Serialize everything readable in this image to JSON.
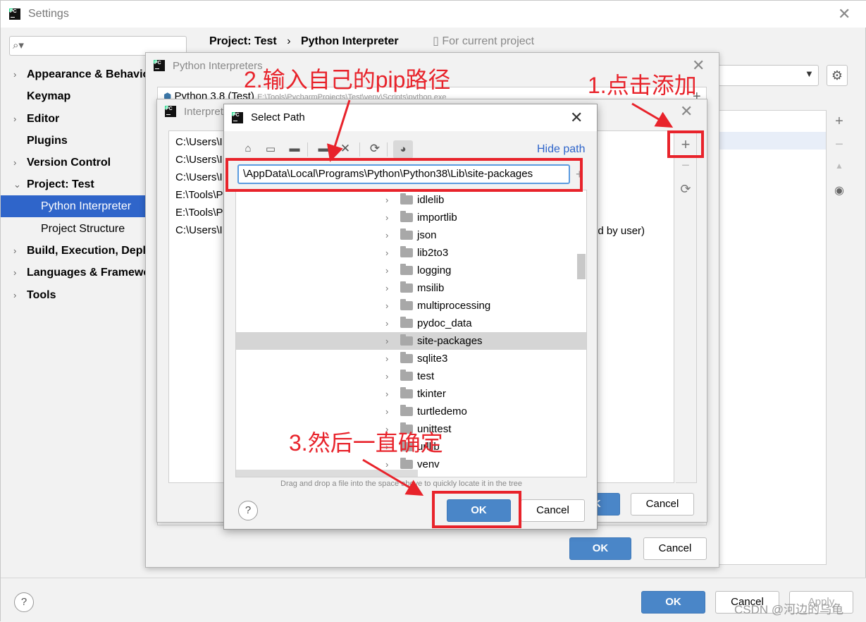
{
  "settings": {
    "title": "Settings",
    "search_placeholder": "",
    "nav": [
      {
        "label": "Appearance & Behavior",
        "chev": "›"
      },
      {
        "label": "Keymap",
        "chev": ""
      },
      {
        "label": "Editor",
        "chev": "›"
      },
      {
        "label": "Plugins",
        "chev": ""
      },
      {
        "label": "Version Control",
        "chev": "›"
      },
      {
        "label": "Project: Test",
        "chev": "⌄"
      },
      {
        "label": "Python Interpreter",
        "chev": ""
      },
      {
        "label": "Project Structure",
        "chev": ""
      },
      {
        "label": "Build, Execution, Deployment",
        "chev": "›"
      },
      {
        "label": "Languages & Frameworks",
        "chev": "›"
      },
      {
        "label": "Tools",
        "chev": "›"
      }
    ],
    "breadcrumb": {
      "project": "Project: Test",
      "sep": "›",
      "page": "Python Interpreter",
      "scope": "For current project"
    },
    "ok": "OK",
    "cancel": "Cancel",
    "apply": "Apply",
    "help": "?",
    "side_toolbar": {
      "add": "+",
      "remove": "−",
      "up": "▲",
      "eye": "👁"
    }
  },
  "interpreters_dialog": {
    "title": "Python Interpreters",
    "item": "Python 3.8 (Test)",
    "item_path": "E:\\Tools\\PycharmProjects\\Test\\venv\\Scripts\\python.exe",
    "ok": "OK",
    "cancel": "Cancel"
  },
  "paths_dialog": {
    "title": "Interpreter Paths",
    "paths": [
      "C:\\Users\\I",
      "C:\\Users\\I",
      "C:\\Users\\I",
      "E:\\Tools\\P",
      "E:\\Tools\\P",
      "C:\\Users\\I"
    ],
    "user_added_note": "ed by user)",
    "ok": "OK",
    "cancel": "Cancel"
  },
  "select_path": {
    "title": "Select Path",
    "hide_path": "Hide path",
    "path_value": "\\AppData\\Local\\Programs\\Python\\Python38\\Lib\\site-packages",
    "folders": [
      "idlelib",
      "importlib",
      "json",
      "lib2to3",
      "logging",
      "msilib",
      "multiprocessing",
      "pydoc_data",
      "site-packages",
      "sqlite3",
      "test",
      "tkinter",
      "turtledemo",
      "unittest",
      "urllib",
      "venv"
    ],
    "selected_folder": "site-packages",
    "hint": "Drag and drop a file into the space above to quickly locate it in the tree",
    "ok": "OK",
    "cancel": "Cancel",
    "help": "?"
  },
  "annotations": {
    "step1": "1.点击添加",
    "step2": "2.输入自己的pip路径",
    "step3": "3.然后一直确定"
  },
  "watermark": "CSDN @河边的乌龟",
  "colors": {
    "annotation_red": "#e8232b",
    "selection_blue": "#2f65ca",
    "primary_button": "#4a86c8"
  }
}
